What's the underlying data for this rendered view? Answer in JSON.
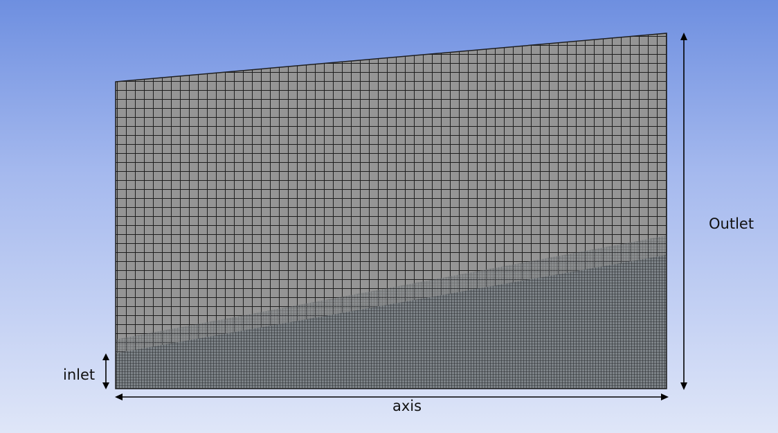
{
  "colors": {
    "background_top": "#6e8fe0",
    "background_bottom": "#dfe6f8",
    "mesh_fill": "#959595",
    "mesh_line": "#1e1e1e",
    "annotation": "#000000"
  },
  "labels": {
    "outlet": "Outlet",
    "inlet": "inlet",
    "axis": "axis"
  }
}
